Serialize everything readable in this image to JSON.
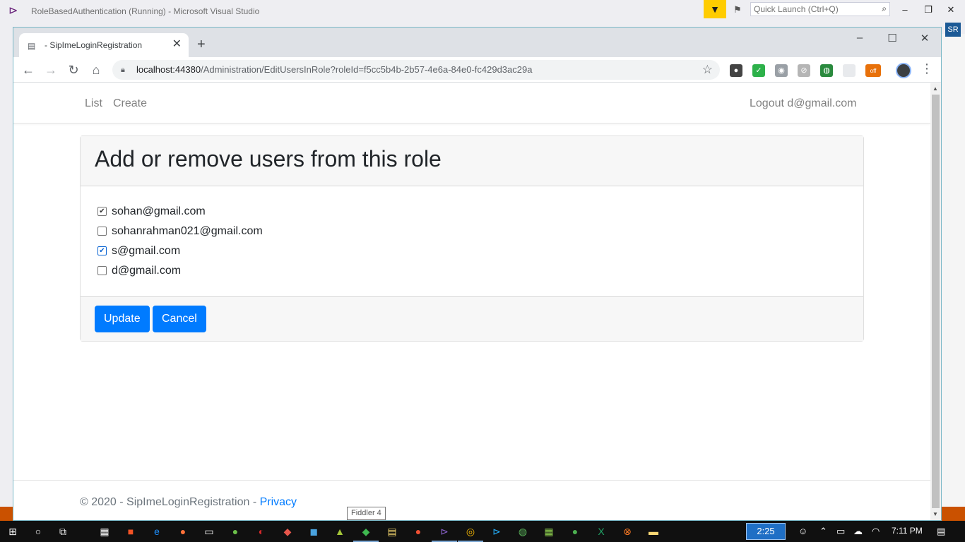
{
  "vs": {
    "title": "RoleBasedAuthentication (Running) - Microsoft Visual Studio",
    "quick_launch_placeholder": "Quick Launch (Ctrl+Q)",
    "user_initials": "SR"
  },
  "browser": {
    "tab_title": "- SipImeLoginRegistration",
    "url_host": "localhost:44380",
    "url_path": "/Administration/EditUsersInRole?roleId=f5cc5b4b-2b57-4e6a-84e0-fc429d3ac29a",
    "extension_badge": "off"
  },
  "navbar": {
    "links": [
      "List",
      "Create"
    ],
    "logout_label": "Logout d@gmail.com"
  },
  "card": {
    "heading": "Add or remove users from this role",
    "users": [
      {
        "email": "sohan@gmail.com",
        "checked": true
      },
      {
        "email": "sohanrahman021@gmail.com",
        "checked": false
      },
      {
        "email": "s@gmail.com",
        "checked": true
      },
      {
        "email": "d@gmail.com",
        "checked": false
      }
    ],
    "update_label": "Update",
    "cancel_label": "Cancel"
  },
  "footer": {
    "copyright": "© 2020 - SipImeLoginRegistration - ",
    "privacy_label": "Privacy"
  },
  "tooltip": {
    "text": "Fiddler 4"
  },
  "taskbar": {
    "time_box": "2:25",
    "clock": "7:11 PM"
  },
  "colors": {
    "primary": "#007bff",
    "vs_filter": "#ffcc00",
    "vs_status_orange": "#ca5100"
  }
}
